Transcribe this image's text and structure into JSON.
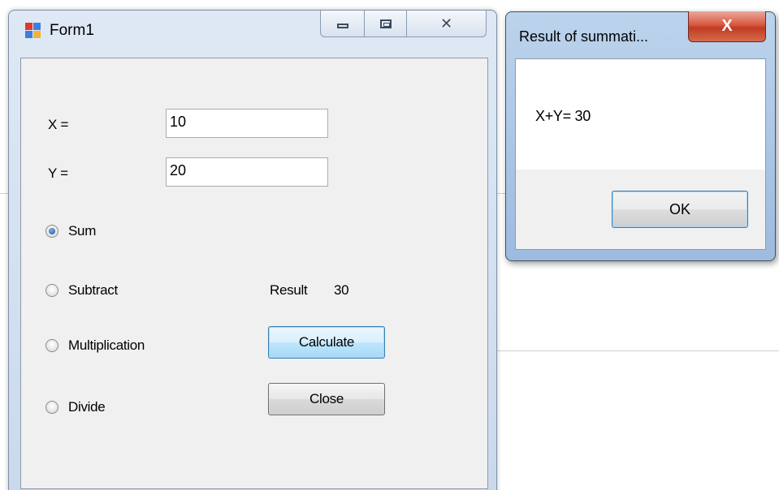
{
  "form": {
    "title": "Form1",
    "x_label": "X =",
    "x_value": "10",
    "y_label": "Y =",
    "y_value": "20",
    "options": [
      {
        "label": "Sum",
        "checked": true
      },
      {
        "label": "Subtract",
        "checked": false
      },
      {
        "label": "Multiplication",
        "checked": false
      },
      {
        "label": "Divide",
        "checked": false
      }
    ],
    "result_label": "Result",
    "result_value": "30",
    "calculate_label": "Calculate",
    "close_label": "Close"
  },
  "message_box": {
    "title": "Result of summati...",
    "text": "X+Y= 30",
    "ok_label": "OK",
    "close_glyph": "X"
  },
  "icons": {
    "minimize": "minimize-icon",
    "maximize": "maximize-icon",
    "close": "close-icon",
    "app": "form-app-icon"
  }
}
